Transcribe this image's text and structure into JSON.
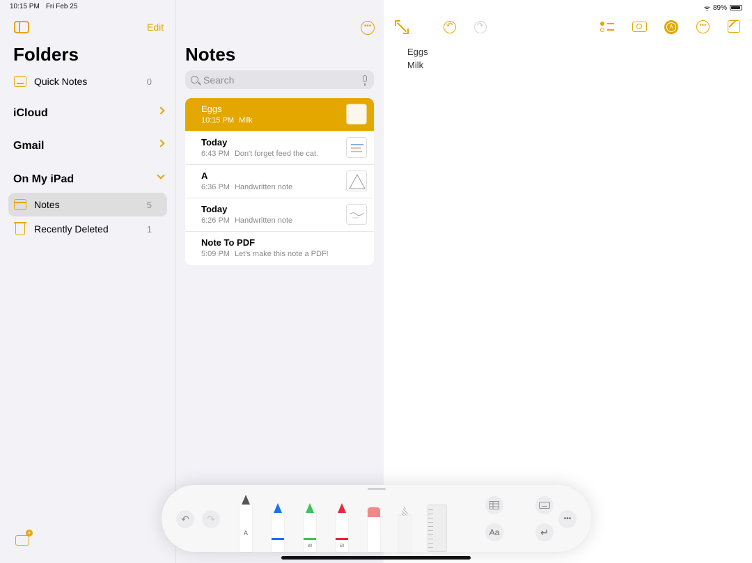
{
  "status": {
    "time": "10:15 PM",
    "date": "Fri Feb 25",
    "battery": "89%"
  },
  "sidebar": {
    "edit_label": "Edit",
    "title": "Folders",
    "quick_notes": {
      "label": "Quick Notes",
      "count": "0"
    },
    "sections": {
      "icloud": "iCloud",
      "gmail": "Gmail",
      "on_my_ipad": "On My iPad"
    },
    "folders": [
      {
        "label": "Notes",
        "count": "5"
      },
      {
        "label": "Recently Deleted",
        "count": "1"
      }
    ]
  },
  "notes_list": {
    "title": "Notes",
    "search_placeholder": "Search",
    "notes": [
      {
        "title": "Eggs",
        "time": "10:15 PM",
        "preview": "Milk"
      },
      {
        "title": "Today",
        "time": "6:43 PM",
        "preview": "Don't forget feed the cat."
      },
      {
        "title": "A",
        "time": "6:36 PM",
        "preview": "Handwritten note"
      },
      {
        "title": "Today",
        "time": "6:26 PM",
        "preview": "Handwritten note"
      },
      {
        "title": "Note To PDF",
        "time": "5:09 PM",
        "preview": "Let's make this note a PDF!"
      }
    ]
  },
  "editor": {
    "lines": [
      "Eggs",
      "Milk"
    ]
  },
  "palette": {
    "pen_label": "A",
    "pencil_label": "50",
    "marker_label": "80",
    "text_style_label": "Aa"
  },
  "colors": {
    "accent": "#e3a700",
    "pen_blue": "#1a73e8",
    "pen_green": "#3cc35a",
    "pen_red": "#e6283a",
    "eraser": "#f08a8a"
  }
}
